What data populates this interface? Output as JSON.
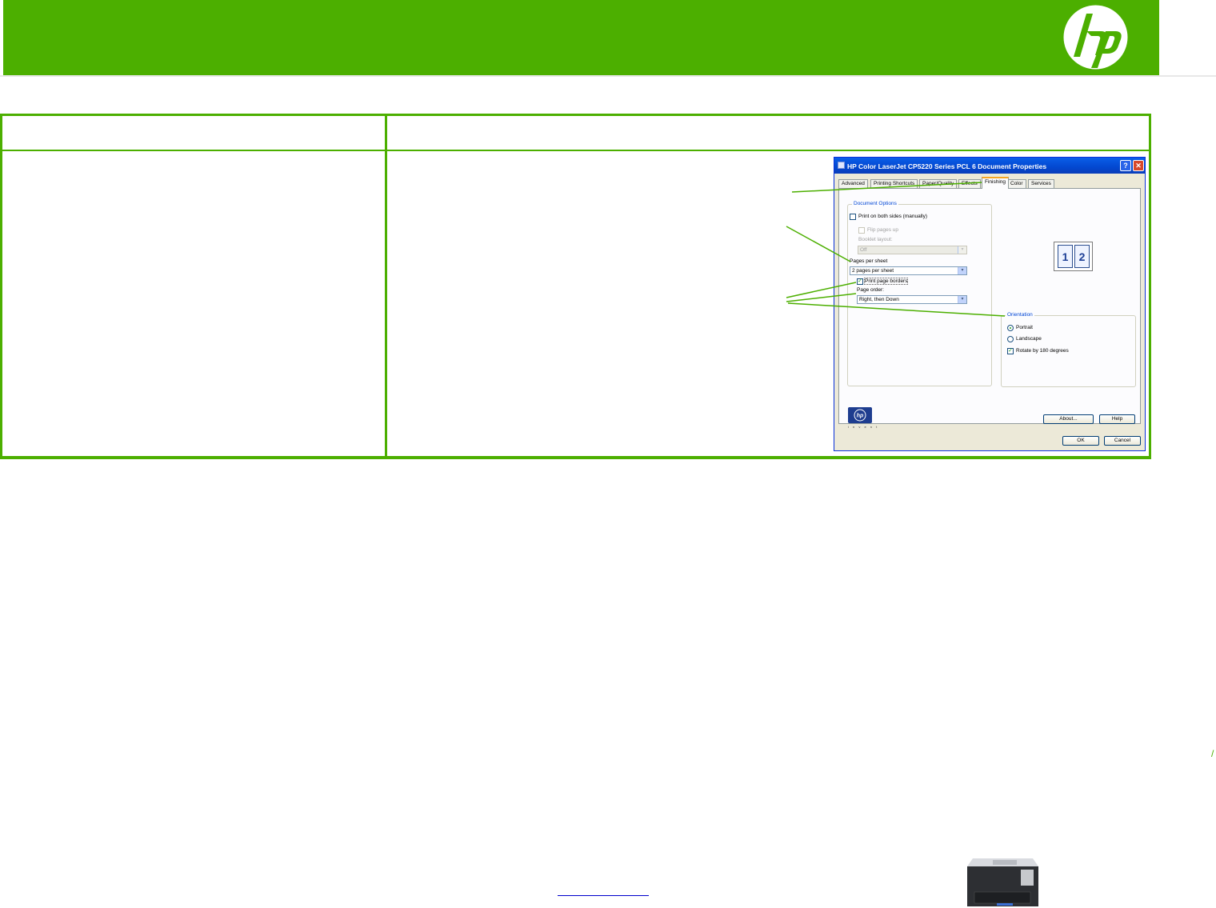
{
  "dialog": {
    "title": "HP Color LaserJet CP5220 Series PCL 6 Document Properties",
    "help_button": "?",
    "close_button": "✕",
    "tabs": [
      "Advanced",
      "Printing Shortcuts",
      "Paper/Quality",
      "Effects",
      "Finishing",
      "Color",
      "Services"
    ],
    "active_tab": "Finishing",
    "document_options": {
      "group_label": "Document Options",
      "print_both_sides": "Print on both sides (manually)",
      "flip_pages_up": "Flip pages up",
      "booklet_layout_label": "Booklet layout:",
      "booklet_layout_value": "Off",
      "pages_per_sheet_label": "Pages per sheet",
      "pages_per_sheet_value": "2 pages per sheet",
      "print_page_borders": "Print page borders",
      "page_order_label": "Page order:",
      "page_order_value": "Right, then Down"
    },
    "preview": {
      "page1": "1",
      "page2": "2"
    },
    "orientation": {
      "group_label": "Orientation",
      "portrait": "Portrait",
      "landscape": "Landscape",
      "rotate": "Rotate by 180 degrees",
      "selected": "Portrait"
    },
    "checked": {
      "print_both_sides": false,
      "flip_pages_up": false,
      "print_page_borders": true,
      "rotate": true
    },
    "buttons": {
      "about": "About...",
      "help": "Help",
      "ok": "OK",
      "cancel": "Cancel"
    },
    "logo_tagline": "i n v e n t"
  },
  "colors": {
    "hp_green": "#4caf00",
    "xp_blue": "#0348d0"
  }
}
